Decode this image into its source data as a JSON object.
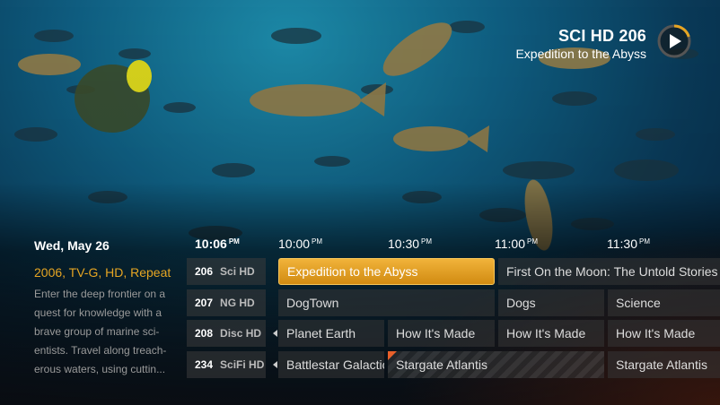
{
  "now_playing": {
    "channel": "SCI HD 206",
    "program": "Expedition to the Abyss"
  },
  "info": {
    "date": "Wed, May 26",
    "meta": "2006, TV-G, HD, Repeat",
    "description_lines": [
      "Enter the deep frontier on a",
      "quest for knowledge with a",
      "brave group of marine sci-",
      "entists. Travel along treach-",
      "erous waters, using cuttin..."
    ]
  },
  "timeline": {
    "current": {
      "time": "10:06",
      "ampm": "PM"
    },
    "slots": [
      {
        "time": "10:00",
        "ampm": "PM"
      },
      {
        "time": "10:30",
        "ampm": "PM"
      },
      {
        "time": "11:00",
        "ampm": "PM"
      },
      {
        "time": "11:30",
        "ampm": "PM"
      }
    ]
  },
  "guide": {
    "rows": [
      {
        "number": "206",
        "name": "Sci HD",
        "programs": [
          "Expedition to the Abyss",
          "First On the Moon: The Untold Stories"
        ]
      },
      {
        "number": "207",
        "name": "NG HD",
        "programs": [
          "DogTown",
          "Dogs",
          "Science"
        ]
      },
      {
        "number": "208",
        "name": "Disc HD",
        "programs": [
          "Planet Earth",
          "How It's Made",
          "How It's Made",
          "How It's Made"
        ]
      },
      {
        "number": "234",
        "name": "SciFi HD",
        "programs": [
          "Battlestar Galactica",
          "Stargate Atlantis",
          "Stargate Atlantis"
        ]
      }
    ]
  },
  "colors": {
    "accent": "#e6a523",
    "selected_cell": "#e2a02a",
    "recording_marker": "#e8602a"
  }
}
